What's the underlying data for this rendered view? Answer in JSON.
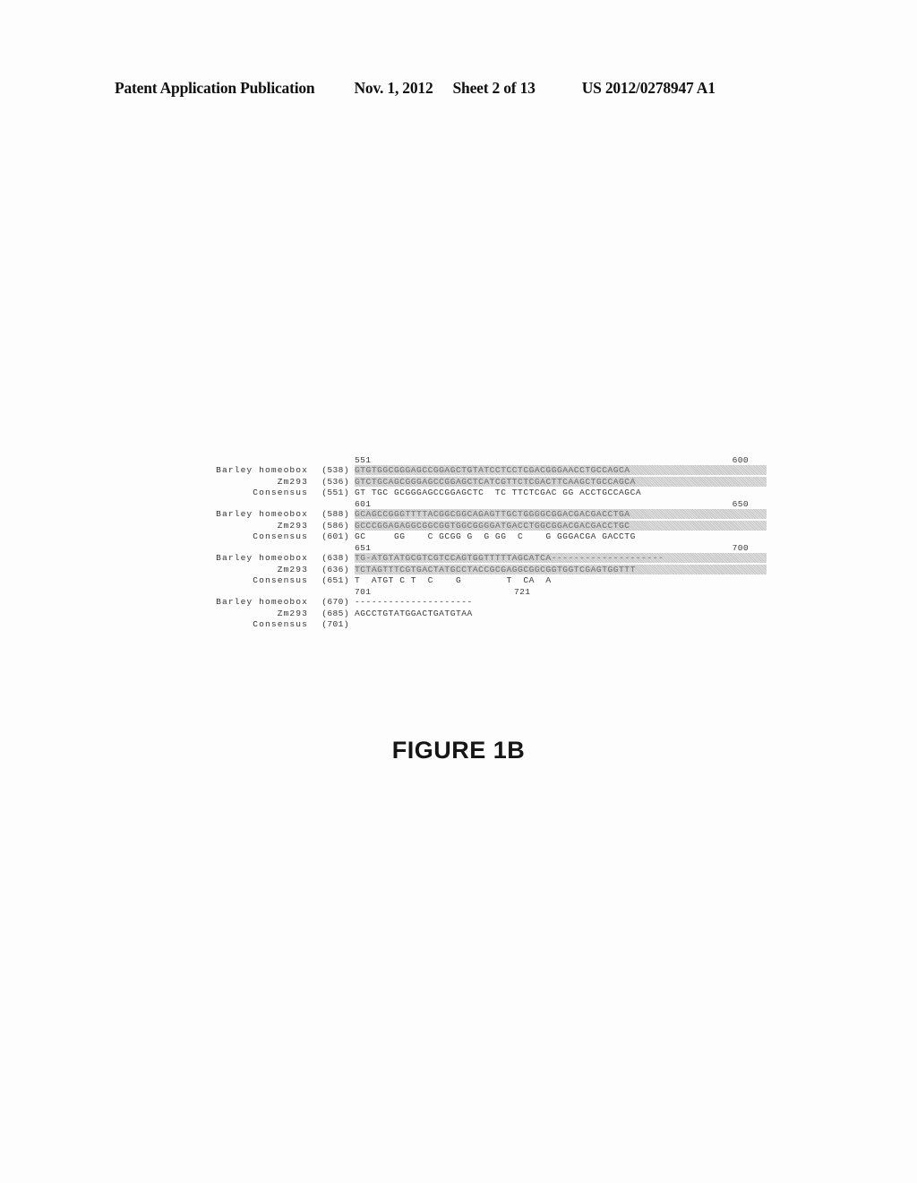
{
  "header": {
    "publication": "Patent Application Publication",
    "date": "Nov. 1, 2012",
    "sheet": "Sheet 2 of 13",
    "patent_number": "US 2012/0278947 A1"
  },
  "figure": {
    "caption": "FIGURE 1B",
    "row_labels": {
      "barley": "Barley homeobox",
      "zm293": "Zm293",
      "consensus": "Consensus"
    },
    "blocks": [
      {
        "ruler_left": "551",
        "ruler_right": "600",
        "ruler_style": "right-edge",
        "rows": [
          {
            "name": "Barley homeobox",
            "pos": "(538)",
            "seq": "GTGTGGCGGGAGCCGGAGCTGTATCCTCCTCGACGGGAACCTGCCAGCA",
            "shaded": true
          },
          {
            "name": "Zm293",
            "pos": "(536)",
            "seq": "GTCTGCAGCGGGAGCCGGAGCTCATCGTTCTCGACTTCAAGCTGCCAGCA",
            "shaded": true
          },
          {
            "name": "Consensus",
            "pos": "(551)",
            "seq": "GT TGC GCGGGAGCCGGAGCTC  TC TTCTCGAC GG ACCTGCCAGCA",
            "shaded": false
          }
        ]
      },
      {
        "ruler_left": "601",
        "ruler_right": "650",
        "ruler_style": "right-edge",
        "rows": [
          {
            "name": "Barley homeobox",
            "pos": "(588)",
            "seq": "GCAGCCGGGTTTTACGGCGGCAGAGTTGCTGGGGCGGACGACGACCTGA",
            "shaded": true
          },
          {
            "name": "Zm293",
            "pos": "(586)",
            "seq": "GCCCGGAGAGGCGGCGGTGGCGGGGATGACCTGGCGGACGACGACCTGC",
            "shaded": true
          },
          {
            "name": "Consensus",
            "pos": "(601)",
            "seq": "GC     GG    C GCGG G  G GG  C    G GGGACGA GACCTG",
            "shaded": false
          }
        ]
      },
      {
        "ruler_left": "651",
        "ruler_right": "700",
        "ruler_style": "right-edge",
        "rows": [
          {
            "name": "Barley homeobox",
            "pos": "(638)",
            "seq": "TG-ATGTATGCGTCGTCCAGTGGTTTTTAGCATCA--------------------",
            "shaded": true
          },
          {
            "name": "Zm293",
            "pos": "(636)",
            "seq": "TCTAGTTTCGTGACTATGCCTACCGCGAGGCGGCGGTGGTCGAGTGGTTT",
            "shaded": true
          },
          {
            "name": "Consensus",
            "pos": "(651)",
            "seq": "T  ATGT C T  C    G        T  CA  A",
            "shaded": false
          }
        ]
      },
      {
        "ruler_left": "701",
        "ruler_right": "721",
        "ruler_style": "mid-edge",
        "rows": [
          {
            "name": "Barley homeobox",
            "pos": "(670)",
            "seq": "---------------------",
            "shaded": false
          },
          {
            "name": "Zm293",
            "pos": "(685)",
            "seq": "AGCCTGTATGGACTGATGTAA",
            "shaded": false
          },
          {
            "name": "Consensus",
            "pos": "(701)",
            "seq": "",
            "shaded": false
          }
        ]
      }
    ]
  }
}
